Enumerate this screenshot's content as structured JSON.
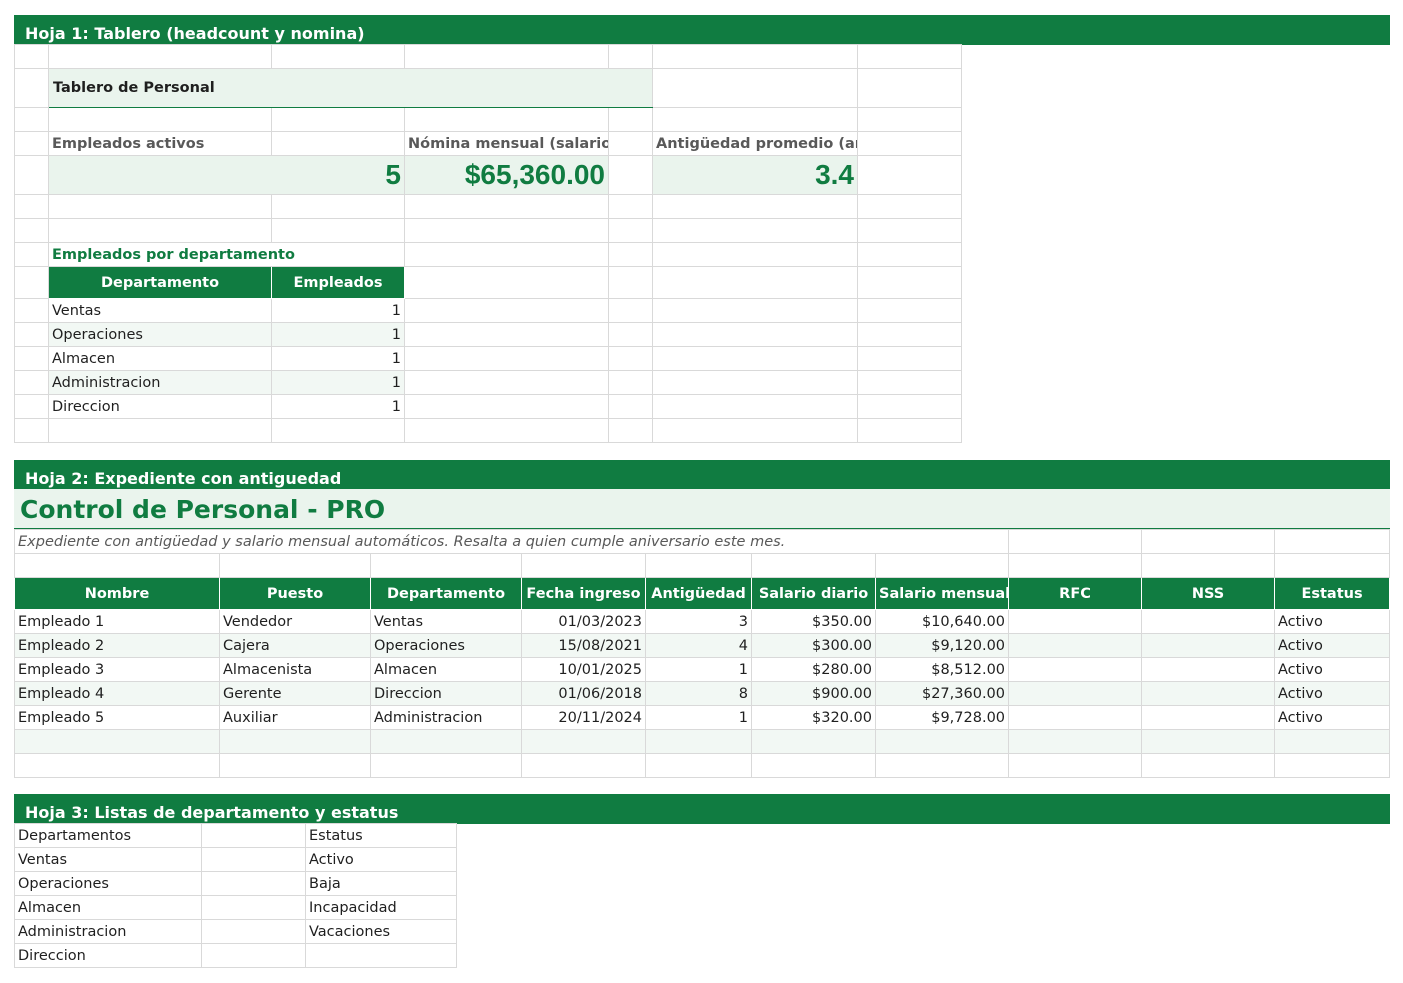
{
  "sheet1": {
    "band": "Hoja 1: Tablero (headcount y nomina)",
    "title": "Tablero de Personal",
    "kpis": [
      {
        "label": "Empleados activos",
        "value": "5"
      },
      {
        "label": "Nómina mensual (salarios)",
        "value": "$65,360.00"
      },
      {
        "label": "Antigüedad promedio (años)",
        "value": "3.4"
      }
    ],
    "dept_section_title": "Empleados por departamento",
    "dept_headers": [
      "Departamento",
      "Empleados"
    ],
    "dept_rows": [
      {
        "name": "Ventas",
        "count": "1"
      },
      {
        "name": "Operaciones",
        "count": "1"
      },
      {
        "name": "Almacen",
        "count": "1"
      },
      {
        "name": "Administracion",
        "count": "1"
      },
      {
        "name": "Direccion",
        "count": "1"
      }
    ]
  },
  "sheet2": {
    "band": "Hoja 2: Expediente con antiguedad",
    "title": "Control de Personal - PRO",
    "note": "Expediente con antigüedad y salario mensual automáticos. Resalta a quien cumple aniversario este mes.",
    "headers": [
      "Nombre",
      "Puesto",
      "Departamento",
      "Fecha ingreso",
      "Antigüedad",
      "Salario diario",
      "Salario mensual",
      "RFC",
      "NSS",
      "Estatus"
    ],
    "rows": [
      [
        "Empleado 1",
        "Vendedor",
        "Ventas",
        "01/03/2023",
        "3",
        "$350.00",
        "$10,640.00",
        "",
        "",
        "Activo"
      ],
      [
        "Empleado 2",
        "Cajera",
        "Operaciones",
        "15/08/2021",
        "4",
        "$300.00",
        "$9,120.00",
        "",
        "",
        "Activo"
      ],
      [
        "Empleado 3",
        "Almacenista",
        "Almacen",
        "10/01/2025",
        "1",
        "$280.00",
        "$8,512.00",
        "",
        "",
        "Activo"
      ],
      [
        "Empleado 4",
        "Gerente",
        "Direccion",
        "01/06/2018",
        "8",
        "$900.00",
        "$27,360.00",
        "",
        "",
        "Activo"
      ],
      [
        "Empleado 5",
        "Auxiliar",
        "Administracion",
        "20/11/2024",
        "1",
        "$320.00",
        "$9,728.00",
        "",
        "",
        "Activo"
      ]
    ]
  },
  "sheet3": {
    "band": "Hoja 3: Listas de departamento y estatus",
    "dept_header": "Departamentos",
    "status_header": "Estatus",
    "departments": [
      "Ventas",
      "Operaciones",
      "Almacen",
      "Administracion",
      "Direccion"
    ],
    "statuses": [
      "Activo",
      "Baja",
      "Incapacidad",
      "Vacaciones"
    ]
  },
  "colors": {
    "accent": "#107c41",
    "tint": "#eaf4ed",
    "alt_row": "#f2f8f4",
    "grid": "#d9d9d9"
  }
}
